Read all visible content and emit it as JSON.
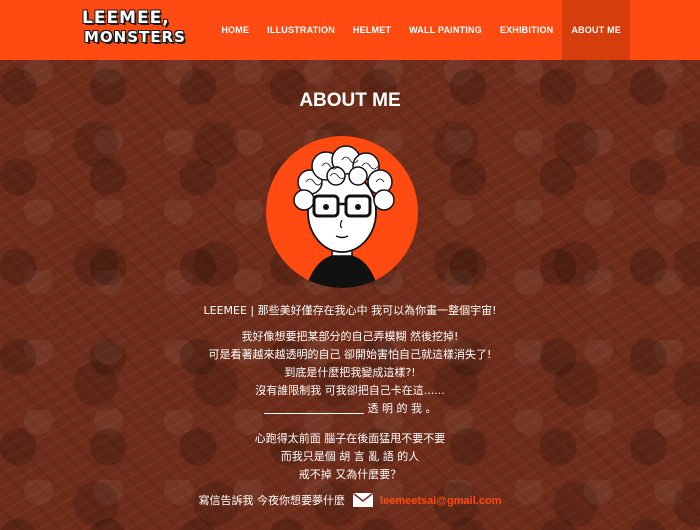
{
  "header": {
    "logo_line1": "LEEMEE,",
    "logo_line2": "MONSTERS",
    "nav": [
      "HOME",
      "ILLUSTRATION",
      "HELMET",
      "WALL PAINTING",
      "EXHIBITION",
      "ABOUT ME"
    ],
    "active_index": 5
  },
  "main": {
    "title": "ABOUT ME",
    "intro": "LEEMEE | 那些美好僅存在我心中 我可以為你畫一整個宇宙!",
    "para1": [
      "我好像想要把某部分的自己弄模糊 然後挖掉!",
      "可是看著越來越透明的自己 卻開始害怕自己就這樣消失了!",
      "到底是什麼把我變成這樣?!",
      "沒有誰限制我 可我卻把自己卡在這......",
      "透 明 的 我 。"
    ],
    "para2": [
      "心跑得太前面 腦子在後面猛甩不要不要",
      "而我只是個 胡 言 亂 語 的人",
      "戒不掉 又為什麼要？"
    ],
    "contact_text": "寫信告訴我 今夜你想要夢什麼",
    "email": "leemeetsai@gmail.com"
  },
  "colors": {
    "accent": "#ff4a12",
    "background": "#6e2d1a",
    "nav_active": "#d63d0c"
  }
}
